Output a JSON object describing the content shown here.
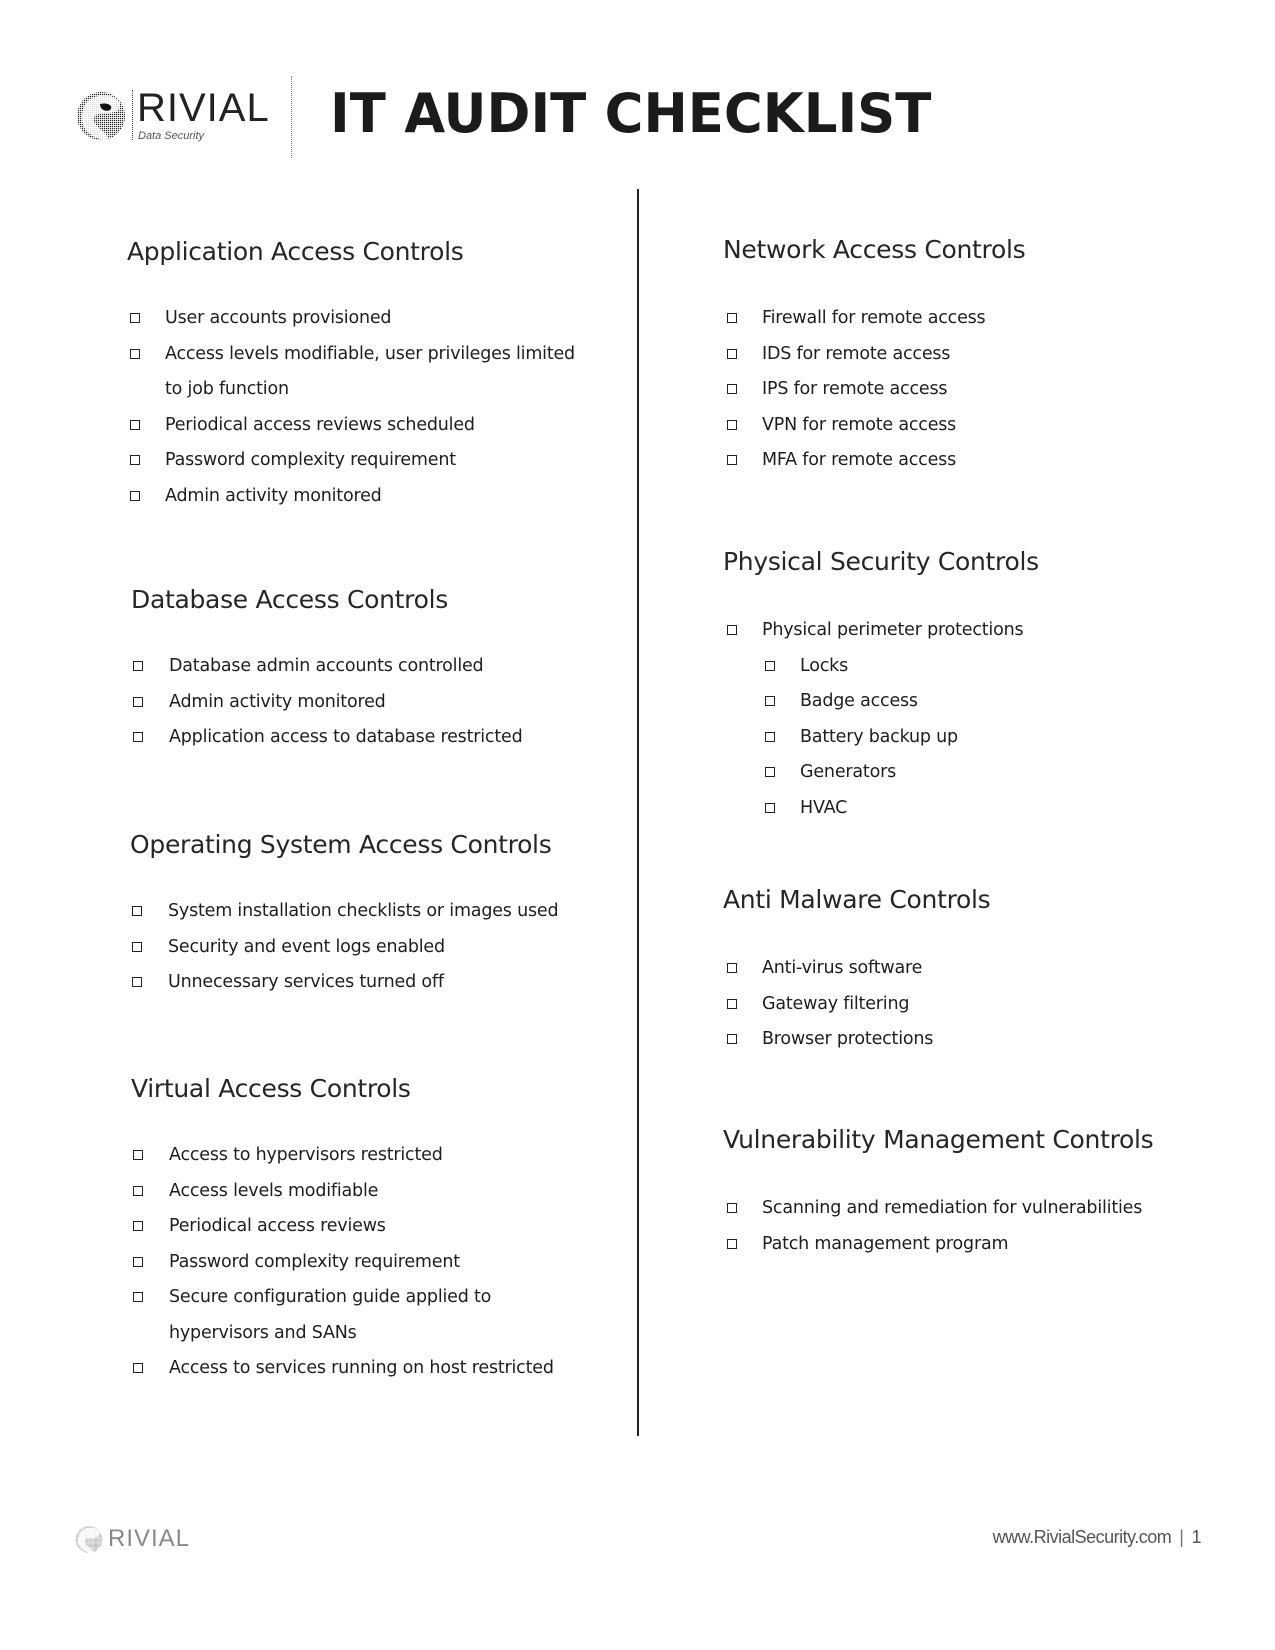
{
  "header": {
    "logo": {
      "name": "RIVIAL",
      "tagline": "Data Security",
      "icon": "globe-swirl-icon"
    },
    "title": "IT AUDIT CHECKLIST"
  },
  "left_column": [
    {
      "heading": "Application Access Controls",
      "items": [
        {
          "text": "User accounts provisioned",
          "checked": false
        },
        {
          "text": "Access levels modifiable, user privileges limited to job function",
          "checked": false
        },
        {
          "text": "Periodical access reviews scheduled",
          "checked": false
        },
        {
          "text": "Password complexity requirement",
          "checked": false
        },
        {
          "text": "Admin activity monitored",
          "checked": false
        }
      ]
    },
    {
      "heading": "Database Access Controls",
      "items": [
        {
          "text": "Database admin accounts controlled",
          "checked": false
        },
        {
          "text": "Admin activity monitored",
          "checked": false
        },
        {
          "text": "Application access to database restricted",
          "checked": false
        }
      ]
    },
    {
      "heading": "Operating System Access Controls",
      "items": [
        {
          "text": "System installation checklists or images used",
          "checked": false
        },
        {
          "text": "Security and event logs enabled",
          "checked": false
        },
        {
          "text": "Unnecessary services turned off",
          "checked": false
        }
      ]
    },
    {
      "heading": "Virtual Access Controls",
      "items": [
        {
          "text": "Access to hypervisors restricted",
          "checked": false
        },
        {
          "text": "Access levels modifiable",
          "checked": false
        },
        {
          "text": "Periodical access reviews",
          "checked": false
        },
        {
          "text": "Password complexity requirement",
          "checked": false
        },
        {
          "text": "Secure configuration guide applied to hypervisors and SANs",
          "checked": false
        },
        {
          "text": "Access to services running on host restricted",
          "checked": false
        }
      ]
    }
  ],
  "right_column": [
    {
      "heading": "Network Access Controls",
      "items": [
        {
          "text": "Firewall for remote access",
          "checked": false
        },
        {
          "text": "IDS for remote access",
          "checked": false
        },
        {
          "text": "IPS for remote access",
          "checked": false
        },
        {
          "text": "VPN for remote access",
          "checked": false
        },
        {
          "text": "MFA for remote access",
          "checked": false
        }
      ]
    },
    {
      "heading": "Physical Security Controls",
      "items": [
        {
          "text": "Physical perimeter protections",
          "checked": false
        },
        {
          "text": "Locks",
          "checked": false,
          "sub": true
        },
        {
          "text": "Badge access",
          "checked": false,
          "sub": true
        },
        {
          "text": "Battery backup up",
          "checked": false,
          "sub": true
        },
        {
          "text": "Generators",
          "checked": false,
          "sub": true
        },
        {
          "text": "HVAC",
          "checked": false,
          "sub": true
        }
      ]
    },
    {
      "heading": "Anti Malware Controls",
      "items": [
        {
          "text": "Anti-virus software",
          "checked": false
        },
        {
          "text": "Gateway filtering",
          "checked": false
        },
        {
          "text": "Browser protections",
          "checked": false
        }
      ]
    },
    {
      "heading": "Vulnerability Management Controls",
      "items": [
        {
          "text": "Scanning and remediation for vulnerabilities",
          "checked": false
        },
        {
          "text": "Patch management program",
          "checked": false
        }
      ]
    }
  ],
  "footer": {
    "logo_name": "RIVIAL",
    "website": "www.RivialSecurity.com",
    "separator": "|",
    "page_number": "1"
  }
}
